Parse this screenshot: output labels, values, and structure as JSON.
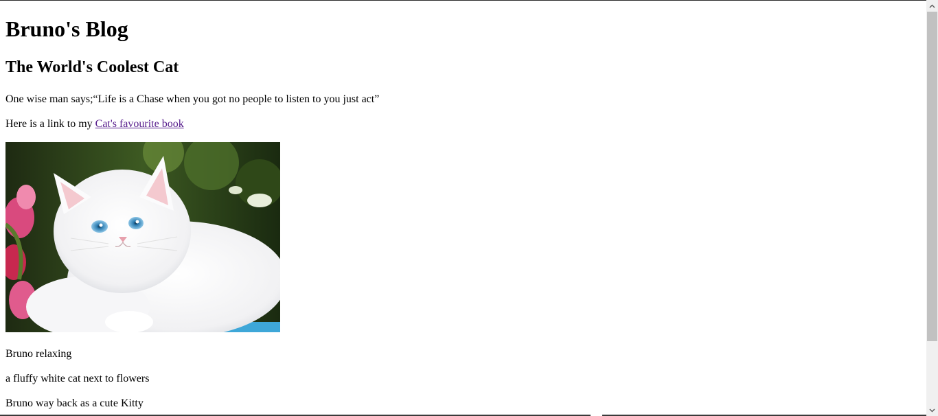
{
  "blog": {
    "title": "Bruno's Blog",
    "subtitle": "The World's Coolest Cat",
    "quote": "One wise man says;“Life is a Chase when you got no people to listen to you just act”",
    "link_prefix": "Here is a link to my ",
    "link_text": "Cat's favourite book",
    "image_alt": "a fluffy white cat next to flowers",
    "captions": [
      "Bruno relaxing",
      "a fluffy white cat next to flowers",
      "Bruno way back as a cute Kitty"
    ]
  },
  "colors": {
    "link_visited": "#551a8b",
    "scrollbar_track": "#f0f0f0",
    "scrollbar_thumb": "#c1c1c1"
  },
  "icons": {
    "scroll_up": "chevron-up-icon",
    "scroll_down": "chevron-down-icon"
  }
}
